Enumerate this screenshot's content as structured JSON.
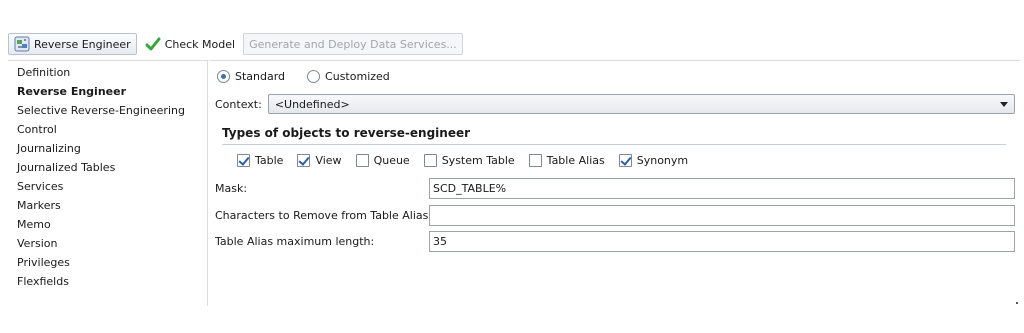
{
  "toolbar": {
    "reverse_engineer_label": "Reverse Engineer",
    "check_model_label": "Check Model",
    "generate_label": "Generate and Deploy Data Services..."
  },
  "nav": {
    "items": [
      {
        "label": "Definition",
        "active": false
      },
      {
        "label": "Reverse Engineer",
        "active": true
      },
      {
        "label": "Selective Reverse-Engineering",
        "active": false
      },
      {
        "label": "Control",
        "active": false
      },
      {
        "label": "Journalizing",
        "active": false
      },
      {
        "label": "Journalized Tables",
        "active": false
      },
      {
        "label": "Services",
        "active": false
      },
      {
        "label": "Markers",
        "active": false
      },
      {
        "label": "Memo",
        "active": false
      },
      {
        "label": "Version",
        "active": false
      },
      {
        "label": "Privileges",
        "active": false
      },
      {
        "label": "Flexfields",
        "active": false
      }
    ]
  },
  "mode": {
    "standard_label": "Standard",
    "customized_label": "Customized",
    "selected": "Standard"
  },
  "context": {
    "label": "Context:",
    "value": "<Undefined>"
  },
  "object_types": {
    "title": "Types of objects to reverse-engineer",
    "options": [
      {
        "label": "Table",
        "checked": true
      },
      {
        "label": "View",
        "checked": true
      },
      {
        "label": "Queue",
        "checked": false
      },
      {
        "label": "System Table",
        "checked": false
      },
      {
        "label": "Table Alias",
        "checked": false
      },
      {
        "label": "Synonym",
        "checked": true
      }
    ]
  },
  "fields": {
    "mask_label": "Mask:",
    "mask_value": "SCD_TABLE%",
    "chars_label": "Characters to Remove from Table Alias:",
    "chars_value": "",
    "alias_len_label": "Table Alias maximum length:",
    "alias_len_value": "35"
  },
  "colors": {
    "check_accent": "#2b5ea8",
    "check_icon_green": "#3aa33a"
  }
}
